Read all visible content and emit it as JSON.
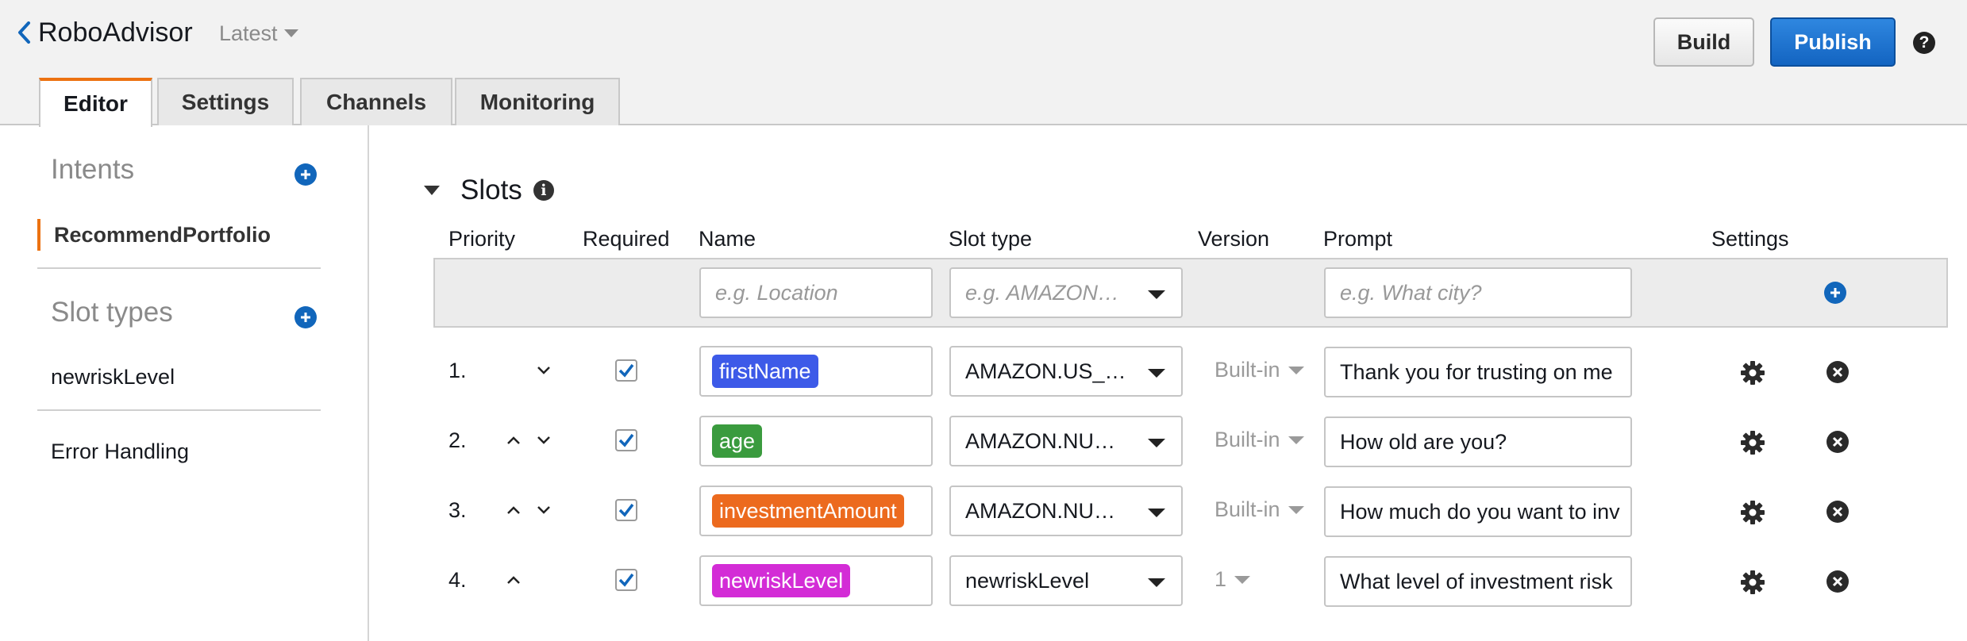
{
  "header": {
    "bot_name": "RoboAdvisor",
    "version_label": "Latest",
    "build_label": "Build",
    "publish_label": "Publish",
    "help_glyph": "?"
  },
  "tabs": [
    {
      "label": "Editor",
      "active": true
    },
    {
      "label": "Settings",
      "active": false
    },
    {
      "label": "Channels",
      "active": false
    },
    {
      "label": "Monitoring",
      "active": false
    }
  ],
  "sidebar": {
    "intents_heading": "Intents",
    "intents": [
      "RecommendPortfolio"
    ],
    "slot_types_heading": "Slot types",
    "slot_types": [
      "newriskLevel"
    ],
    "error_handling": "Error Handling"
  },
  "slots": {
    "title": "Slots",
    "info_glyph": "i",
    "columns": {
      "priority": "Priority",
      "required": "Required",
      "name": "Name",
      "slot_type": "Slot type",
      "version": "Version",
      "prompt": "Prompt",
      "settings": "Settings"
    },
    "new_row": {
      "name_placeholder": "e.g. Location",
      "type_placeholder": "e.g. AMAZON…",
      "prompt_placeholder": "e.g. What city?"
    },
    "rows": [
      {
        "priority": "1.",
        "required": true,
        "name": "firstName",
        "tag_color": "#3d5ae8",
        "slot_type": "AMAZON.US_…",
        "version": "Built-in",
        "prompt": "Thank you for trusting on me"
      },
      {
        "priority": "2.",
        "required": true,
        "name": "age",
        "tag_color": "#3a9b3e",
        "slot_type": "AMAZON.NU…",
        "version": "Built-in",
        "prompt": "How old are you?"
      },
      {
        "priority": "3.",
        "required": true,
        "name": "investmentAmount",
        "tag_color": "#ec6a1e",
        "slot_type": "AMAZON.NU…",
        "version": "Built-in",
        "prompt": "How much do you want to inv"
      },
      {
        "priority": "4.",
        "required": true,
        "name": "newriskLevel",
        "tag_color": "#d32cd6",
        "slot_type": "newriskLevel",
        "version": "1",
        "prompt": "What level of investment risk"
      }
    ]
  },
  "colors": {
    "accent_orange": "#ec7211",
    "primary_blue": "#1364c1",
    "icon_blue": "#1166bb"
  }
}
